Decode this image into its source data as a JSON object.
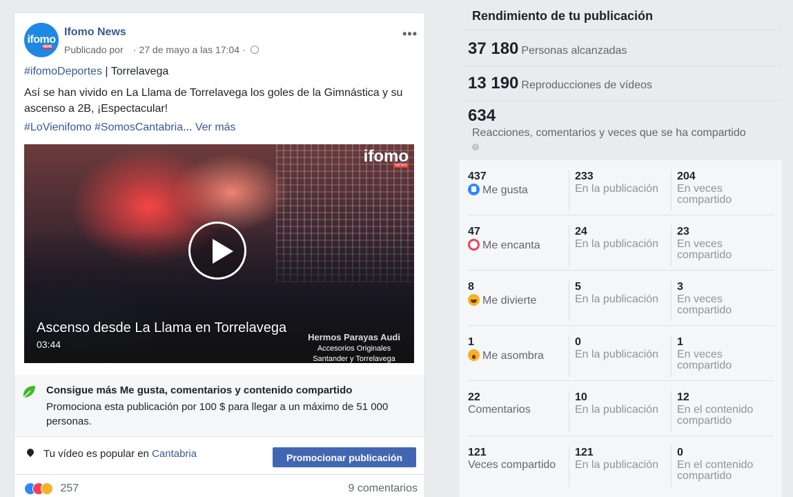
{
  "post": {
    "page_name": "Ifomo News",
    "avatar_text": "ifomo",
    "avatar_sub": "NEWS",
    "published_by": "Publicado por",
    "date": "· 27 de mayo a las 17:04 ·",
    "more": "•••",
    "hashtag": "#ifomoDeportes",
    "location_sep": " | Torrelavega",
    "body": "Así se han vivido en La Llama de Torrelavega los goles de la Gimnástica y su ascenso a 2B, ¡Espectacular!",
    "tags": "#LoVienifomo #SomosCantabria",
    "tags_ellipsis": "... ",
    "see_more": "Ver más",
    "video": {
      "brand": "ifomo",
      "brand_sub": "NEWS",
      "title": "Ascenso desde La Llama en Torrelavega",
      "duration": "03:44",
      "ad_line1": "Hermos Parayas Audi",
      "ad_line2": "Accesorios Originales",
      "ad_line3": "Santander y Torrelavega"
    },
    "promo": {
      "title": "Consigue más Me gusta, comentarios y contenido compartido",
      "desc": "Promociona esta publicación por 100 $ para llegar a un máximo de 51 000 personas."
    },
    "popular": {
      "text": "Tu vídeo es popular en ",
      "place": "Cantabria",
      "button": "Promocionar publicación"
    },
    "reactions_count": "257",
    "comments": "9 comentarios"
  },
  "panel": {
    "title": "Rendimiento de tu publicación",
    "reach": {
      "value": "37 180",
      "label": "Personas alcanzadas"
    },
    "views": {
      "value": "13 190",
      "label": "Reproducciones de vídeos"
    },
    "engagement": {
      "value": "634",
      "label": "Reacciones, comentarios y veces que se ha compartido"
    },
    "rows": [
      {
        "icon": "like",
        "total": "437",
        "label": "Me gusta",
        "post": "233",
        "post_label": "En la publicación",
        "shared": "204",
        "shared_label": "En veces compartido"
      },
      {
        "icon": "love",
        "total": "47",
        "label": "Me encanta",
        "post": "24",
        "post_label": "En la publicación",
        "shared": "23",
        "shared_label": "En veces compartido"
      },
      {
        "icon": "haha",
        "total": "8",
        "label": "Me divierte",
        "post": "5",
        "post_label": "En la publicación",
        "shared": "3",
        "shared_label": "En veces compartido"
      },
      {
        "icon": "wow",
        "total": "1",
        "label": "Me asombra",
        "post": "0",
        "post_label": "En la publicación",
        "shared": "1",
        "shared_label": "En veces compartido"
      },
      {
        "icon": "",
        "total": "22",
        "label": "Comentarios",
        "post": "10",
        "post_label": "En la publicación",
        "shared": "12",
        "shared_label": "En el contenido compartido"
      },
      {
        "icon": "",
        "total": "121",
        "label": "Veces compartido",
        "post": "121",
        "post_label": "En la publicación",
        "shared": "0",
        "shared_label": "En el contenido compartido"
      }
    ]
  },
  "colors": {
    "brand_blue": "#4267b2",
    "link": "#385898",
    "like": "#2d88ff",
    "love": "#f33e58",
    "haha": "#f7b125"
  }
}
